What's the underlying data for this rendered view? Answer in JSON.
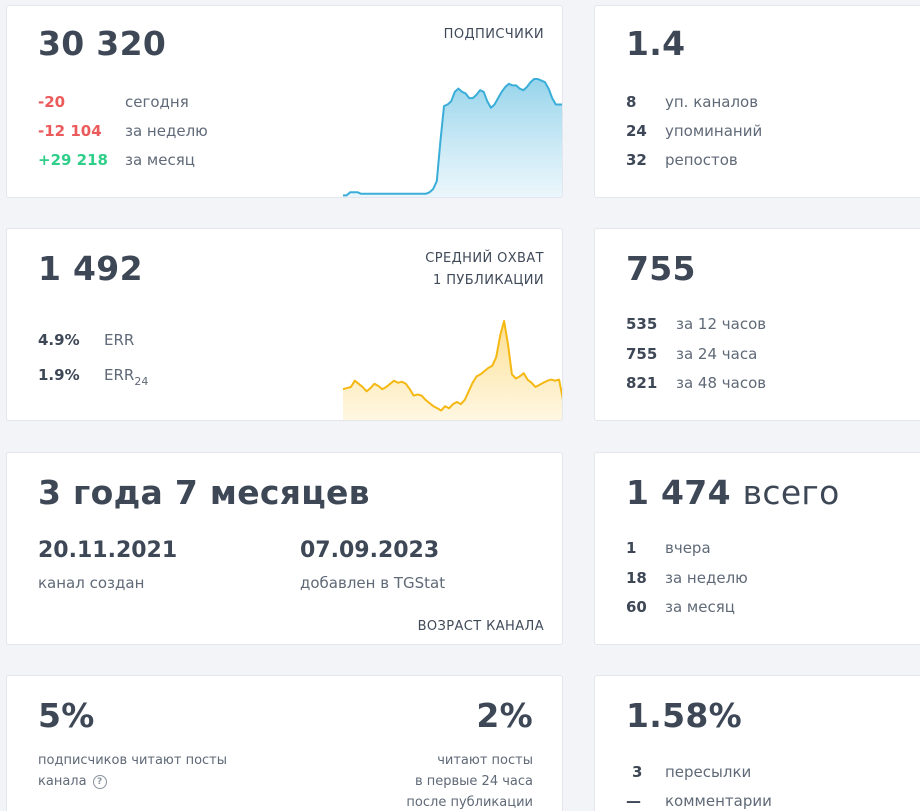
{
  "subscribers": {
    "value": "30 320",
    "caption": "ПОДПИСЧИКИ",
    "rows": [
      {
        "value": "-20",
        "label": "сегодня"
      },
      {
        "value": "-12 104",
        "label": "за неделю"
      },
      {
        "value": "+29 218",
        "label": "за месяц"
      }
    ],
    "chart_data": {
      "type": "area",
      "color": "#3aaed8",
      "values": [
        1,
        1,
        3,
        3,
        3,
        2,
        2,
        2,
        2,
        2,
        2,
        2,
        2,
        2,
        2,
        2,
        2,
        2,
        2,
        2,
        2,
        2,
        2,
        2,
        3,
        5,
        10,
        35,
        57,
        58,
        60,
        66,
        68,
        66,
        65,
        62,
        62,
        64,
        67,
        66,
        60,
        56,
        58,
        62,
        66,
        69,
        71,
        70,
        70,
        68,
        67,
        69,
        72,
        74,
        74,
        73,
        72,
        68,
        62,
        58,
        58,
        58
      ]
    }
  },
  "mentions": {
    "value": "1.4",
    "rows": [
      {
        "value": "8",
        "label": "уп. каналов"
      },
      {
        "value": "24",
        "label": "упоминаний"
      },
      {
        "value": "32",
        "label": "репостов"
      }
    ]
  },
  "reach": {
    "value": "1 492",
    "caption_line1": "СРЕДНИЙ ОХВАТ",
    "caption_line2": "1 ПУБЛИКАЦИИ",
    "err_value": "4.9%",
    "err_label": "ERR",
    "err24_value": "1.9%",
    "err24_label": "ERR",
    "err24_sub": "24",
    "chart_data": {
      "type": "area",
      "color": "#f5b813",
      "values": [
        28,
        29,
        30,
        36,
        33,
        30,
        26,
        29,
        33,
        31,
        28,
        30,
        33,
        36,
        34,
        35,
        33,
        28,
        22,
        23,
        22,
        18,
        15,
        12,
        10,
        8,
        12,
        10,
        14,
        16,
        14,
        18,
        26,
        34,
        40,
        42,
        45,
        48,
        50,
        58,
        78,
        92,
        70,
        42,
        38,
        40,
        43,
        37,
        34,
        30,
        32,
        34,
        36,
        37,
        36,
        37,
        18
      ]
    }
  },
  "views": {
    "value": "755",
    "rows": [
      {
        "value": "535",
        "label": "за 12 часов"
      },
      {
        "value": "755",
        "label": "за 24 часа"
      },
      {
        "value": "821",
        "label": "за 48 часов"
      }
    ]
  },
  "age": {
    "value": "3 года 7 месяцев",
    "created_date": "20.11.2021",
    "created_label": "канал создан",
    "added_date": "07.09.2023",
    "added_label": "добавлен в TGStat",
    "caption": "ВОЗРАСТ КАНАЛА"
  },
  "posts": {
    "value": "1 474",
    "value_suffix": "всего",
    "rows": [
      {
        "value": "1",
        "label": "вчера"
      },
      {
        "value": "18",
        "label": "за неделю"
      },
      {
        "value": "60",
        "label": "за месяц"
      }
    ]
  },
  "readers": {
    "left_value": "5%",
    "left_line1": "подписчиков читают посты",
    "left_line2": "канала",
    "help_glyph": "?",
    "right_value": "2%",
    "right_line1": "читают посты",
    "right_line2": "в первые 24 часа",
    "right_line3": "после публикации"
  },
  "engagement": {
    "value": "1.58%",
    "rows": [
      {
        "value": "3",
        "label": "пересылки"
      },
      {
        "value": "—",
        "label": "комментарии"
      }
    ]
  }
}
